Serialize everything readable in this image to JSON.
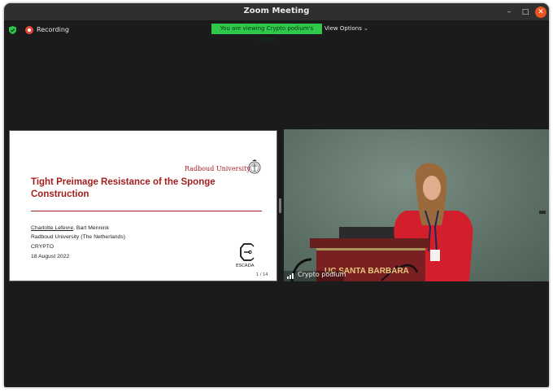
{
  "window": {
    "title": "Zoom Meeting",
    "minimize_glyph": "–",
    "maximize_glyph": "□",
    "close_glyph": "✕"
  },
  "toolbar": {
    "security_icon": "shield-icon",
    "recording_label": "Recording",
    "viewing_banner": "You are viewing Crypto podium's screen",
    "view_options_label": "View Options ⌄"
  },
  "slide": {
    "university": "Radboud University",
    "title": "Tight Preimage Resistance of the Sponge Construction",
    "author_underlined": "Charlotte Lefevre",
    "author_rest": ", Bart Mennink",
    "affiliation": "Radboud University (The Netherlands)",
    "venue": "CRYPTO",
    "date": "18 August 2022",
    "logo_label": "ESCADA",
    "page_indicator": "1 / 14"
  },
  "video": {
    "participant_name": "Crypto podium",
    "podium_text": "UC SANTA BARBARA"
  },
  "colors": {
    "accent_red": "#a31f1f",
    "banner_green": "#2ec84b",
    "close_orange": "#e95420",
    "shirt_red": "#d21f2b"
  }
}
